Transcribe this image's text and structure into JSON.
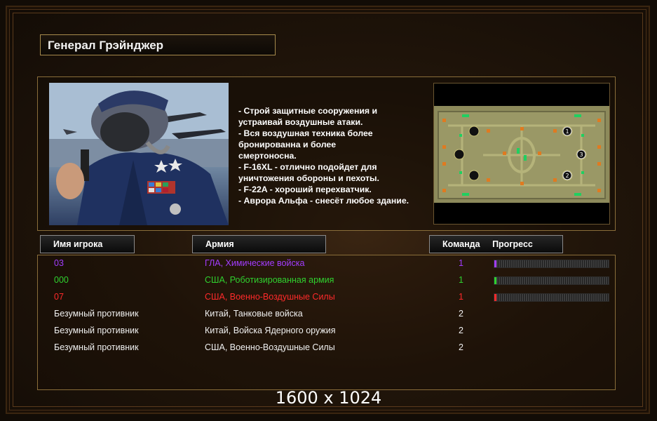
{
  "title": "Генерал Грэйнджер",
  "description": [
    "- Строй защитные сооружения и",
    " устраивай воздушные атаки.",
    "- Вся воздушная техника более",
    " бронированна и более",
    "смертоносна.",
    "- F-16XL - отлично подойдет для",
    " уничтожения обороны и пехоты.",
    "- F-22A - хороший перехватчик.",
    "- Аврора Альфа - снесёт любое здание."
  ],
  "headers": {
    "player": "Имя игрока",
    "army": "Армия",
    "team": "Команда",
    "progress": "Прогресс"
  },
  "players": [
    {
      "name": "03",
      "army": "ГЛА, Химические войска",
      "team": "1",
      "color": "#a33cff",
      "progress": 0.01
    },
    {
      "name": "000",
      "army": "США, Роботизированная армия",
      "team": "1",
      "color": "#2fd12f",
      "progress": 0.01
    },
    {
      "name": "07",
      "army": "США, Военно-Воздушные Силы",
      "team": "1",
      "color": "#ff2a2a",
      "progress": 0.01
    },
    {
      "name": "Безумный противник",
      "army": "Китай, Танковые войска",
      "team": "2",
      "color": "#f0f0f0",
      "progress": null
    },
    {
      "name": "Безумный противник",
      "army": "Китай, Войска Ядерного оружия",
      "team": "2",
      "color": "#f0f0f0",
      "progress": null
    },
    {
      "name": "Безумный противник",
      "army": "США, Военно-Воздушные Силы",
      "team": "2",
      "color": "#f0f0f0",
      "progress": null
    }
  ],
  "minimap_markers": [
    "1",
    "2",
    "3"
  ],
  "resolution": "1600 x 1024"
}
